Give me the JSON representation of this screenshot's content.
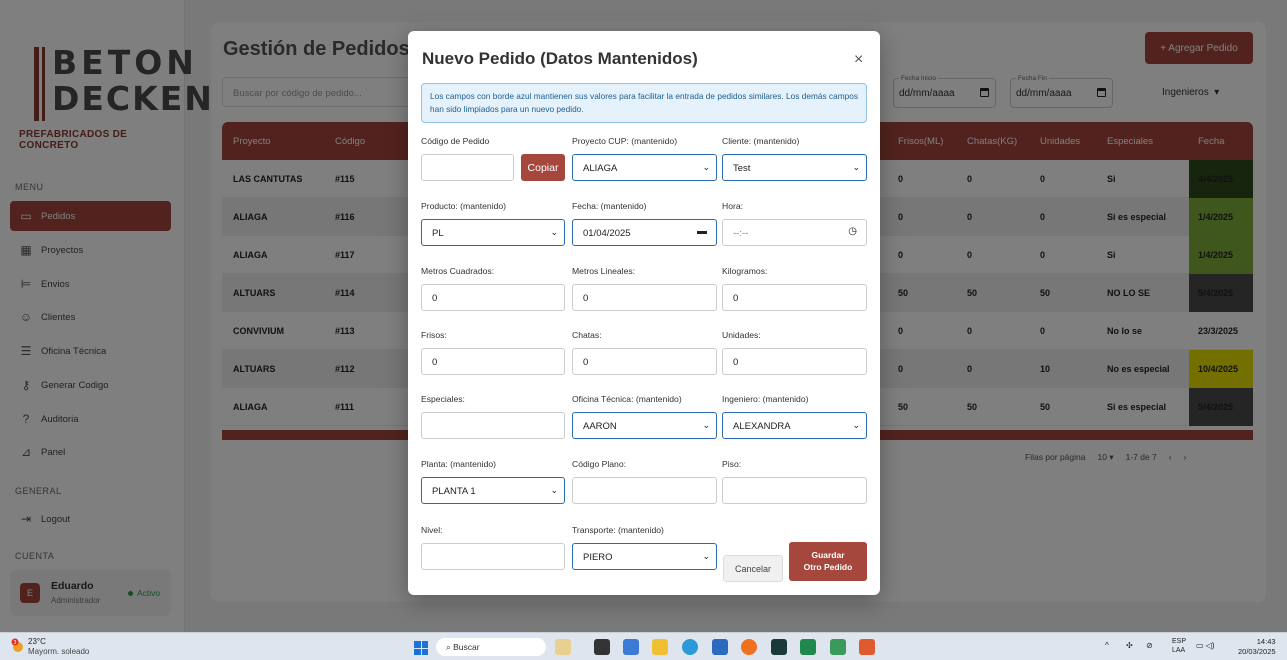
{
  "brand": {
    "line1": "BETON",
    "line2": "DECKEN",
    "tagline": "PREFABRICADOS DE CONCRETO",
    "color": "#a5473c"
  },
  "sidebar": {
    "menu_label": "MENU",
    "items": [
      {
        "label": "Pedidos",
        "icon": "calendar-icon",
        "active": true
      },
      {
        "label": "Proyectos",
        "icon": "building-icon"
      },
      {
        "label": "Envios",
        "icon": "chart-icon"
      },
      {
        "label": "Clientes",
        "icon": "users-icon"
      },
      {
        "label": "Oficina Técnica",
        "icon": "office-icon"
      },
      {
        "label": "Generar Codigo",
        "icon": "key-icon"
      },
      {
        "label": "Auditoria",
        "icon": "help-icon"
      },
      {
        "label": "Panel",
        "icon": "panel-icon"
      }
    ],
    "general_label": "GENERAL",
    "logout_label": "Logout",
    "account_label": "CUENTA",
    "user": {
      "initial": "E",
      "name": "Eduardo",
      "role": "Administrador",
      "status": "Activo"
    }
  },
  "page": {
    "title": "Gestión de Pedidos",
    "search_placeholder": "Buscar por código de pedido...",
    "add_button": "+ Agregar Pedido",
    "date_start_label": "Fecha Inicio",
    "date_start_value": "dd/mm/aaaa",
    "date_end_label": "Fecha Fin",
    "date_end_value": "dd/mm/aaaa",
    "filter_select": "Ingenieros"
  },
  "table": {
    "columns": [
      "Proyecto",
      "Código",
      "Frisos(ML)",
      "Chatas(KG)",
      "Unidades",
      "Especiales",
      "Fecha"
    ],
    "rows": [
      {
        "proyecto": "LAS CANTUTAS",
        "codigo": "#115",
        "frisos": "0",
        "chatas": "0",
        "unidades": "0",
        "especiales": "Si",
        "fecha": "4/4/2025",
        "fecha_color": "#2f4a1c"
      },
      {
        "proyecto": "ALIAGA",
        "codigo": "#116",
        "frisos": "0",
        "chatas": "0",
        "unidades": "0",
        "especiales": "Si es especial",
        "fecha": "1/4/2025",
        "fecha_color": "#7fae3a"
      },
      {
        "proyecto": "ALIAGA",
        "codigo": "#117",
        "frisos": "0",
        "chatas": "0",
        "unidades": "0",
        "especiales": "Si",
        "fecha": "1/4/2025",
        "fecha_color": "#7fae3a"
      },
      {
        "proyecto": "ALTUARS",
        "codigo": "#114",
        "frisos": "50",
        "chatas": "50",
        "unidades": "50",
        "especiales": "NO LO SE",
        "fecha": "5/4/2025",
        "fecha_color": "#4a4a4a"
      },
      {
        "proyecto": "CONVIVIUM",
        "codigo": "#113",
        "frisos": "0",
        "chatas": "0",
        "unidades": "0",
        "especiales": "No lo se",
        "fecha": "23/3/2025",
        "fecha_color": ""
      },
      {
        "proyecto": "ALTUARS",
        "codigo": "#112",
        "frisos": "0",
        "chatas": "0",
        "unidades": "10",
        "especiales": "No es especial",
        "fecha": "10/4/2025",
        "fecha_color": "#e8e000"
      },
      {
        "proyecto": "ALIAGA",
        "codigo": "#111",
        "frisos": "50",
        "chatas": "50",
        "unidades": "50",
        "especiales": "Si es especial",
        "fecha": "5/4/2025",
        "fecha_color": "#4a4a4a"
      }
    ],
    "rows_per_page_label": "Filas por página",
    "rows_per_page": "10",
    "range": "1-7 de 7"
  },
  "modal": {
    "title": "Nuevo Pedido (Datos Mantenidos)",
    "info": "Los campos con borde azul mantienen sus valores para facilitar la entrada de pedidos similares. Los demás campos han sido limpiados para un nuevo pedido.",
    "fields": {
      "codigo": {
        "label": "Código de Pedido",
        "value": ""
      },
      "proyecto": {
        "label": "Proyecto CUP: (mantenido)",
        "value": "ALIAGA"
      },
      "cliente": {
        "label": "Cliente: (mantenido)",
        "value": "Test"
      },
      "producto": {
        "label": "Producto: (mantenido)",
        "value": "PL"
      },
      "fecha": {
        "label": "Fecha: (mantenido)",
        "value": "01/04/2025"
      },
      "hora": {
        "label": "Hora:",
        "value": "--:--"
      },
      "m2": {
        "label": "Metros Cuadrados:",
        "value": "0"
      },
      "ml": {
        "label": "Metros Lineales:",
        "value": "0"
      },
      "kg": {
        "label": "Kilogramos:",
        "value": "0"
      },
      "frisos": {
        "label": "Frisos:",
        "value": "0"
      },
      "chatas": {
        "label": "Chatas:",
        "value": "0"
      },
      "unidades": {
        "label": "Unidades:",
        "value": "0"
      },
      "especiales": {
        "label": "Especiales:",
        "value": ""
      },
      "oficina": {
        "label": "Oficina Técnica: (mantenido)",
        "value": "AARON"
      },
      "ingeniero": {
        "label": "Ingeniero: (mantenido)",
        "value": "ALEXANDRA"
      },
      "planta": {
        "label": "Planta: (mantenido)",
        "value": "PLANTA 1"
      },
      "plano": {
        "label": "Código Plano:",
        "value": ""
      },
      "piso": {
        "label": "Piso:",
        "value": ""
      },
      "nivel": {
        "label": "Nivel:",
        "value": ""
      },
      "transporte": {
        "label": "Transporte: (mantenido)",
        "value": "PIERO"
      }
    },
    "copy_button": "Copiar",
    "cancel_button": "Cancelar",
    "save_button_line1": "Guardar",
    "save_button_line2": "Otro Pedido"
  },
  "taskbar": {
    "weather_temp": "23°C",
    "weather_desc": "Mayorm. soleado",
    "weather_badge": "3",
    "search": "Buscar",
    "lang1": "ESP",
    "lang2": "LAA",
    "time": "14:43",
    "date": "20/03/2025"
  }
}
